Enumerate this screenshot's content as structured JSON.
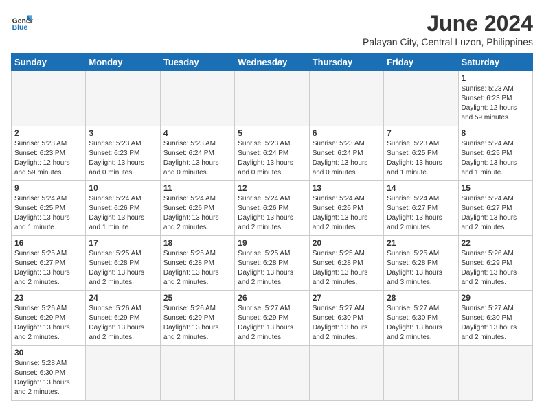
{
  "logo": {
    "text_general": "General",
    "text_blue": "Blue"
  },
  "title": "June 2024",
  "subtitle": "Palayan City, Central Luzon, Philippines",
  "headers": [
    "Sunday",
    "Monday",
    "Tuesday",
    "Wednesday",
    "Thursday",
    "Friday",
    "Saturday"
  ],
  "weeks": [
    [
      {
        "day": "",
        "info": ""
      },
      {
        "day": "",
        "info": ""
      },
      {
        "day": "",
        "info": ""
      },
      {
        "day": "",
        "info": ""
      },
      {
        "day": "",
        "info": ""
      },
      {
        "day": "",
        "info": ""
      },
      {
        "day": "1",
        "info": "Sunrise: 5:23 AM\nSunset: 6:23 PM\nDaylight: 12 hours\nand 59 minutes."
      }
    ],
    [
      {
        "day": "2",
        "info": "Sunrise: 5:23 AM\nSunset: 6:23 PM\nDaylight: 12 hours\nand 59 minutes."
      },
      {
        "day": "3",
        "info": "Sunrise: 5:23 AM\nSunset: 6:23 PM\nDaylight: 13 hours\nand 0 minutes."
      },
      {
        "day": "4",
        "info": "Sunrise: 5:23 AM\nSunset: 6:24 PM\nDaylight: 13 hours\nand 0 minutes."
      },
      {
        "day": "5",
        "info": "Sunrise: 5:23 AM\nSunset: 6:24 PM\nDaylight: 13 hours\nand 0 minutes."
      },
      {
        "day": "6",
        "info": "Sunrise: 5:23 AM\nSunset: 6:24 PM\nDaylight: 13 hours\nand 0 minutes."
      },
      {
        "day": "7",
        "info": "Sunrise: 5:23 AM\nSunset: 6:25 PM\nDaylight: 13 hours\nand 1 minute."
      },
      {
        "day": "8",
        "info": "Sunrise: 5:24 AM\nSunset: 6:25 PM\nDaylight: 13 hours\nand 1 minute."
      }
    ],
    [
      {
        "day": "9",
        "info": "Sunrise: 5:24 AM\nSunset: 6:25 PM\nDaylight: 13 hours\nand 1 minute."
      },
      {
        "day": "10",
        "info": "Sunrise: 5:24 AM\nSunset: 6:26 PM\nDaylight: 13 hours\nand 1 minute."
      },
      {
        "day": "11",
        "info": "Sunrise: 5:24 AM\nSunset: 6:26 PM\nDaylight: 13 hours\nand 2 minutes."
      },
      {
        "day": "12",
        "info": "Sunrise: 5:24 AM\nSunset: 6:26 PM\nDaylight: 13 hours\nand 2 minutes."
      },
      {
        "day": "13",
        "info": "Sunrise: 5:24 AM\nSunset: 6:26 PM\nDaylight: 13 hours\nand 2 minutes."
      },
      {
        "day": "14",
        "info": "Sunrise: 5:24 AM\nSunset: 6:27 PM\nDaylight: 13 hours\nand 2 minutes."
      },
      {
        "day": "15",
        "info": "Sunrise: 5:24 AM\nSunset: 6:27 PM\nDaylight: 13 hours\nand 2 minutes."
      }
    ],
    [
      {
        "day": "16",
        "info": "Sunrise: 5:25 AM\nSunset: 6:27 PM\nDaylight: 13 hours\nand 2 minutes."
      },
      {
        "day": "17",
        "info": "Sunrise: 5:25 AM\nSunset: 6:28 PM\nDaylight: 13 hours\nand 2 minutes."
      },
      {
        "day": "18",
        "info": "Sunrise: 5:25 AM\nSunset: 6:28 PM\nDaylight: 13 hours\nand 2 minutes."
      },
      {
        "day": "19",
        "info": "Sunrise: 5:25 AM\nSunset: 6:28 PM\nDaylight: 13 hours\nand 2 minutes."
      },
      {
        "day": "20",
        "info": "Sunrise: 5:25 AM\nSunset: 6:28 PM\nDaylight: 13 hours\nand 2 minutes."
      },
      {
        "day": "21",
        "info": "Sunrise: 5:25 AM\nSunset: 6:28 PM\nDaylight: 13 hours\nand 3 minutes."
      },
      {
        "day": "22",
        "info": "Sunrise: 5:26 AM\nSunset: 6:29 PM\nDaylight: 13 hours\nand 2 minutes."
      }
    ],
    [
      {
        "day": "23",
        "info": "Sunrise: 5:26 AM\nSunset: 6:29 PM\nDaylight: 13 hours\nand 2 minutes."
      },
      {
        "day": "24",
        "info": "Sunrise: 5:26 AM\nSunset: 6:29 PM\nDaylight: 13 hours\nand 2 minutes."
      },
      {
        "day": "25",
        "info": "Sunrise: 5:26 AM\nSunset: 6:29 PM\nDaylight: 13 hours\nand 2 minutes."
      },
      {
        "day": "26",
        "info": "Sunrise: 5:27 AM\nSunset: 6:29 PM\nDaylight: 13 hours\nand 2 minutes."
      },
      {
        "day": "27",
        "info": "Sunrise: 5:27 AM\nSunset: 6:30 PM\nDaylight: 13 hours\nand 2 minutes."
      },
      {
        "day": "28",
        "info": "Sunrise: 5:27 AM\nSunset: 6:30 PM\nDaylight: 13 hours\nand 2 minutes."
      },
      {
        "day": "29",
        "info": "Sunrise: 5:27 AM\nSunset: 6:30 PM\nDaylight: 13 hours\nand 2 minutes."
      }
    ],
    [
      {
        "day": "30",
        "info": "Sunrise: 5:28 AM\nSunset: 6:30 PM\nDaylight: 13 hours\nand 2 minutes."
      },
      {
        "day": "",
        "info": ""
      },
      {
        "day": "",
        "info": ""
      },
      {
        "day": "",
        "info": ""
      },
      {
        "day": "",
        "info": ""
      },
      {
        "day": "",
        "info": ""
      },
      {
        "day": "",
        "info": ""
      }
    ]
  ]
}
